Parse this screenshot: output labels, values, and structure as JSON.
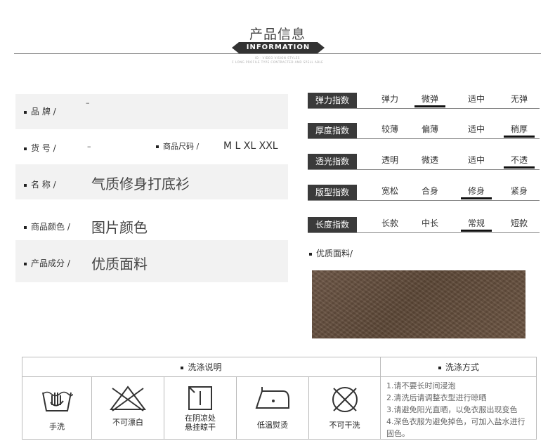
{
  "header": {
    "title": "产品信息",
    "badge": "INFORMATION",
    "sub1": "ID · VIDEO VISION STYLES",
    "sub2": "C LONG PROFILE TYPE CONTRACTED AND SPELL ABLE"
  },
  "info": {
    "brand_label": "品 牌 /",
    "brand_value": "–",
    "sku_label": "货 号 /",
    "sku_value": "–",
    "size_label": "商品尺码 /",
    "size_value": "M L XL XXL",
    "name_label": "名 称 /",
    "name_value": "气质修身打底衫",
    "color_label": "商品颜色 /",
    "color_value": "图片颜色",
    "material_label": "产品成分 /",
    "material_value": "优质面料"
  },
  "indices": [
    {
      "tag": "弹力指数",
      "options": [
        "弹力",
        "微弹",
        "适中",
        "无弹"
      ],
      "selected": 1
    },
    {
      "tag": "厚度指数",
      "options": [
        "较薄",
        "偏薄",
        "适中",
        "稍厚"
      ],
      "selected": 3
    },
    {
      "tag": "透光指数",
      "options": [
        "透明",
        "微透",
        "适中",
        "不透"
      ],
      "selected": 3
    },
    {
      "tag": "版型指数",
      "options": [
        "宽松",
        "合身",
        "修身",
        "紧身"
      ],
      "selected": 2
    },
    {
      "tag": "长度指数",
      "options": [
        "长款",
        "中长",
        "常规",
        "短款"
      ],
      "selected": 2
    }
  ],
  "fabric": {
    "label": "优质面料/"
  },
  "wash": {
    "header_left": "洗涤说明",
    "header_right": "洗涤方式",
    "items": [
      {
        "icon": "hand-wash-icon",
        "caption": "手洗"
      },
      {
        "icon": "no-bleach-icon",
        "caption": "不可漂白"
      },
      {
        "icon": "shade-dry-icon",
        "caption": "在阴凉处\n悬挂晾干"
      },
      {
        "icon": "low-iron-icon",
        "caption": "低温熨烫"
      },
      {
        "icon": "no-dryclean-icon",
        "caption": "不可干洗"
      }
    ],
    "instructions": [
      "1.请不要长时间浸泡",
      "2.清洗后请调整衣型进行晾晒",
      "3.请避免阳光直晒，以免衣服出现变色",
      "4.深色衣服为避免掉色，可加入盐水进行固色。"
    ]
  }
}
